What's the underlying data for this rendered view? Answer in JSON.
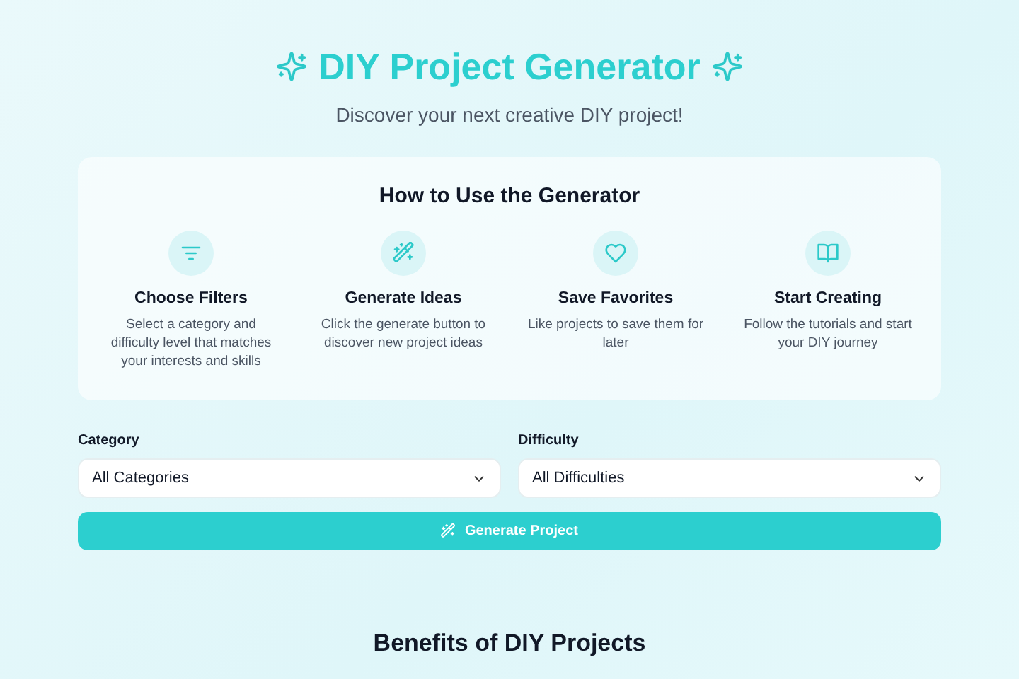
{
  "header": {
    "title": "DIY Project Generator",
    "subtitle": "Discover your next creative DIY project!"
  },
  "guide": {
    "title": "How to Use the Generator",
    "steps": [
      {
        "title": "Choose Filters",
        "text": "Select a category and difficulty level that matches your interests and skills"
      },
      {
        "title": "Generate Ideas",
        "text": "Click the generate button to discover new project ideas"
      },
      {
        "title": "Save Favorites",
        "text": "Like projects to save them for later"
      },
      {
        "title": "Start Creating",
        "text": "Follow the tutorials and start your DIY journey"
      }
    ]
  },
  "filters": [
    {
      "label": "Category",
      "value": "All Categories"
    },
    {
      "label": "Difficulty",
      "value": "All Difficulties"
    }
  ],
  "generate_button": "Generate Project",
  "benefits": {
    "title": "Benefits of DIY Projects"
  }
}
